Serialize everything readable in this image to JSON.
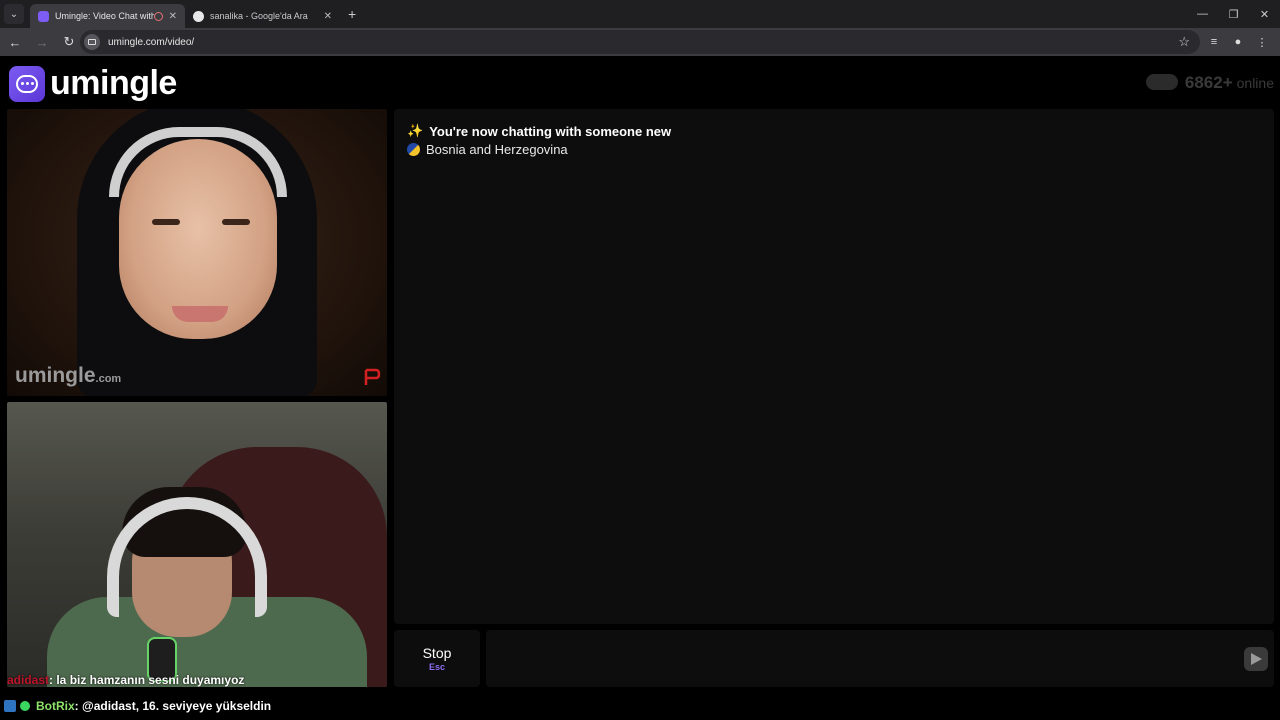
{
  "browser": {
    "tabs": [
      {
        "title": "Umingle: Video Chat with S",
        "active": true
      },
      {
        "title": "sanalika - Google'da Ara",
        "active": false
      }
    ],
    "url": "umingle.com/video/"
  },
  "site": {
    "logo_text": "umingle",
    "online_count": "6862+",
    "online_label": "online"
  },
  "remote_video": {
    "watermark": "umingle",
    "watermark_suffix": ".com"
  },
  "local_video": {
    "overlay_nick": "adidast",
    "overlay_msg": ": la biz hamzanın sesni duyamıyoz"
  },
  "chat": {
    "status_message": "You're now chatting with someone new",
    "country": "Bosnia and Herzegovina"
  },
  "controls": {
    "stop_label": "Stop",
    "stop_key": "Esc"
  },
  "stream_overlay": {
    "bot_name": "BotRix",
    "bot_message": ": @adidast, 16. seviyeye yükseldin"
  },
  "colors": {
    "brand_purple": "#7c5cf2",
    "nick_red": "#c0142b",
    "bot_green": "#8ee36a"
  }
}
